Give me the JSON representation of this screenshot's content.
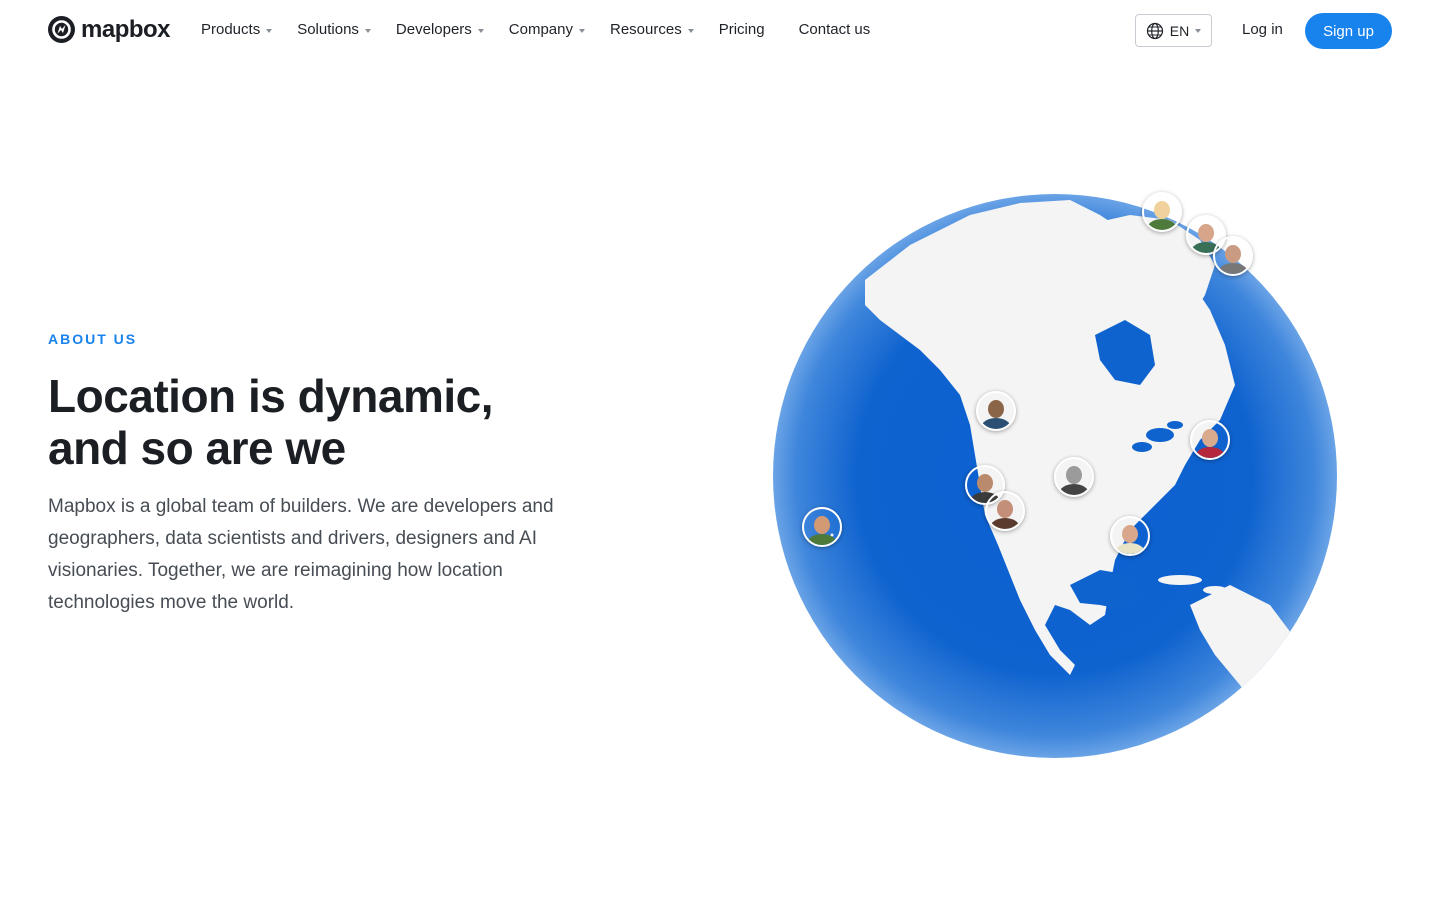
{
  "brand": {
    "name": "mapbox"
  },
  "nav": {
    "items": [
      {
        "label": "Products",
        "has_menu": true
      },
      {
        "label": "Solutions",
        "has_menu": true
      },
      {
        "label": "Developers",
        "has_menu": true
      },
      {
        "label": "Company",
        "has_menu": true
      },
      {
        "label": "Resources",
        "has_menu": true
      },
      {
        "label": "Pricing",
        "has_menu": false
      },
      {
        "label": "Contact us",
        "has_menu": false
      }
    ],
    "language": "EN",
    "login_label": "Log in",
    "signup_label": "Sign up"
  },
  "hero": {
    "eyebrow": "ABOUT US",
    "headline_line1": "Location is dynamic,",
    "headline_line2": "and so are we",
    "description": "Mapbox is a global team of builders. We are developers and geographers, data scientists and drivers, designers and AI visionaries. Together, we are reimagining how location technologies move the world."
  },
  "colors": {
    "accent": "#1882ed",
    "ocean": "#0f63cf",
    "land": "#f4f4f4",
    "text": "#1b1f24",
    "muted_text": "#474d54"
  },
  "icons": [
    "mapbox-logo-icon",
    "globe-icon",
    "chevron-down-icon"
  ]
}
